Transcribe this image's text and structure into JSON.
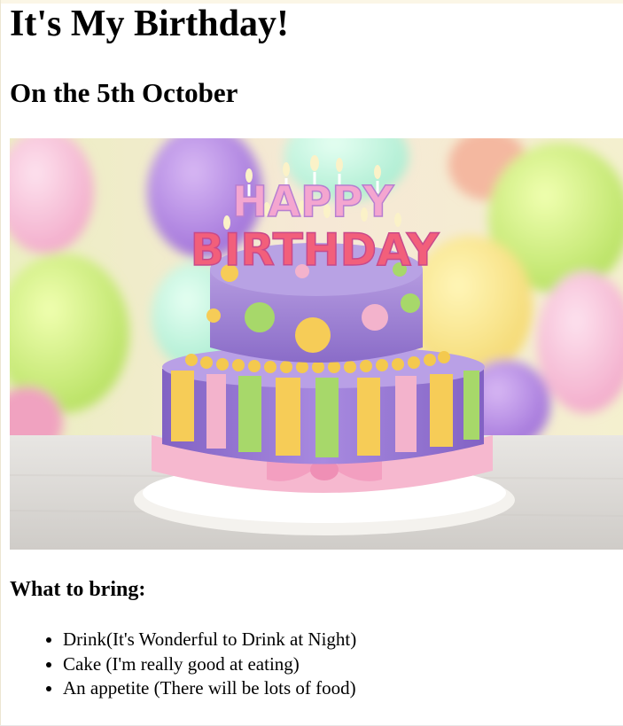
{
  "page": {
    "title": "It's My Birthday!",
    "subtitle": "On the 5th October",
    "image_alt": "birthday-cake-photo",
    "cake_lettering": {
      "line1": "HAPPY",
      "line2": "BIRTHDAY"
    },
    "bring_heading": "What to bring:",
    "bring_items": [
      "Drink(It's Wonderful to Drink at Night)",
      "Cake (I'm really good at eating)",
      "An appetite (There will be lots of food)"
    ]
  },
  "colors": {
    "background": "#ffffff",
    "text": "#000000",
    "cake_purple": "#9b7ad0",
    "cake_yellow": "#f6cc57",
    "cake_green": "#a7d86a",
    "cake_pink": "#f3b3cc"
  }
}
